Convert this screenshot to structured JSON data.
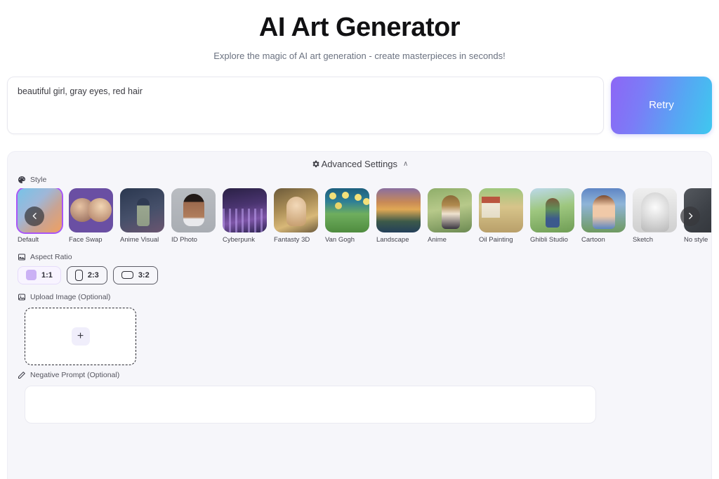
{
  "header": {
    "title": "AI Art Generator",
    "subtitle": "Explore the magic of AI art generation - create masterpieces in seconds!"
  },
  "prompt": {
    "value": "beautiful girl, gray eyes, red hair",
    "placeholder": "",
    "retry_label": "Retry"
  },
  "advanced": {
    "title": "Advanced Settings",
    "caret": "∧",
    "gear_icon": "gear-icon"
  },
  "style": {
    "label": "Style",
    "icon": "palette-brush-icon",
    "prev_icon": "chevron-left-icon",
    "next_icon": "chevron-right-icon",
    "selected": "Default",
    "items": [
      {
        "label": "Default",
        "art": "art-default",
        "selected": true
      },
      {
        "label": "Face Swap",
        "art": "art-faceswap",
        "selected": false
      },
      {
        "label": "Anime Visual",
        "art": "art-animevisual",
        "selected": false
      },
      {
        "label": "ID Photo",
        "art": "art-idphoto",
        "selected": false
      },
      {
        "label": "Cyberpunk",
        "art": "art-cyberpunk",
        "selected": false
      },
      {
        "label": "Fantasty 3D",
        "art": "art-fantasy",
        "selected": false
      },
      {
        "label": "Van Gogh",
        "art": "art-vangogh",
        "selected": false
      },
      {
        "label": "Landscape",
        "art": "art-landscape",
        "selected": false
      },
      {
        "label": "Anime",
        "art": "art-anime",
        "selected": false
      },
      {
        "label": "Oil Painting",
        "art": "art-oil",
        "selected": false
      },
      {
        "label": "Ghibli Studio",
        "art": "art-ghibli",
        "selected": false
      },
      {
        "label": "Cartoon",
        "art": "art-cartoon",
        "selected": false
      },
      {
        "label": "Sketch",
        "art": "art-sketch",
        "selected": false
      },
      {
        "label": "No style",
        "art": "art-nostyle",
        "selected": false
      }
    ]
  },
  "aspect_ratio": {
    "label": "Aspect Ratio",
    "icon": "aspect-ratio-icon",
    "selected": "1:1",
    "options": [
      {
        "label": "1:1",
        "shape": "square",
        "selected": true
      },
      {
        "label": "2:3",
        "shape": "tall",
        "selected": false
      },
      {
        "label": "3:2",
        "shape": "wide",
        "selected": false
      }
    ]
  },
  "upload": {
    "label": "Upload Image (Optional)",
    "icon": "image-icon",
    "add_icon": "plus-icon"
  },
  "negative_prompt": {
    "label": "Negative Prompt (Optional)",
    "icon": "pencil-icon",
    "value": "",
    "placeholder": ""
  },
  "colors": {
    "accent_start": "#8d66f5",
    "accent_end": "#3fc8ef",
    "selected_border": "#a855f7",
    "panel_bg": "#f6f6fa",
    "page_bg": "#ffffff"
  }
}
